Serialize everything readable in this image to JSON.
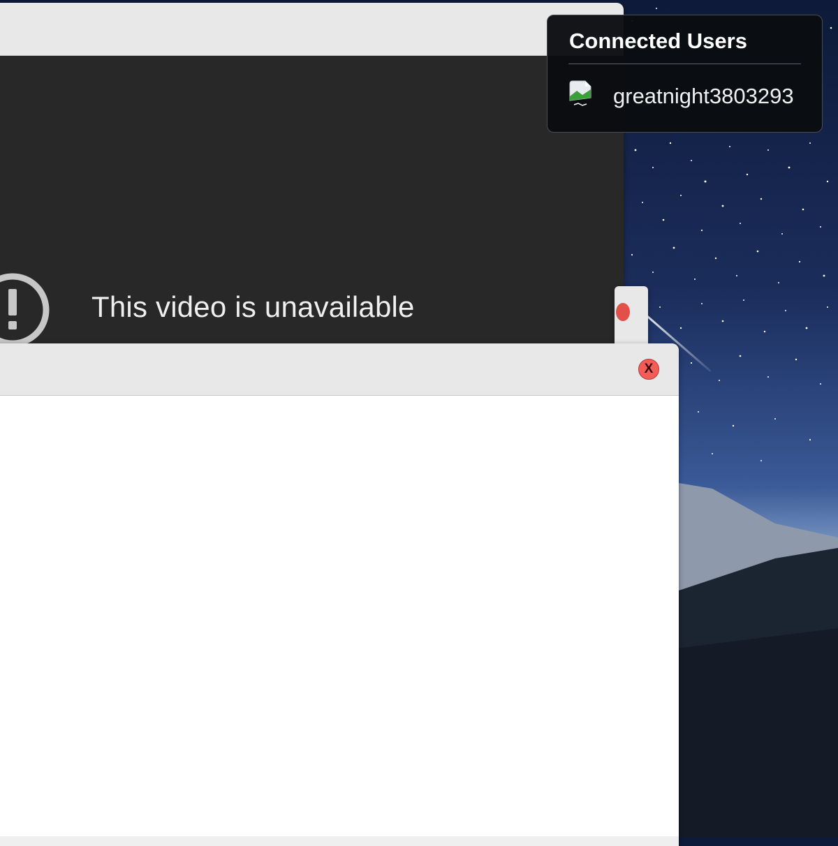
{
  "video": {
    "message": "This video is unavailable",
    "icon": "exclamation-circle-icon"
  },
  "dialog": {
    "close_label": "X",
    "close_color": "#f25d57"
  },
  "users_panel": {
    "title": "Connected Users",
    "users": [
      {
        "name": "greatnight3803293",
        "avatar_icon": "broken-image-icon"
      }
    ]
  },
  "colors": {
    "video_background": "#282828",
    "titlebar": "#e8e8e8",
    "panel_background": "#0a0c10"
  }
}
